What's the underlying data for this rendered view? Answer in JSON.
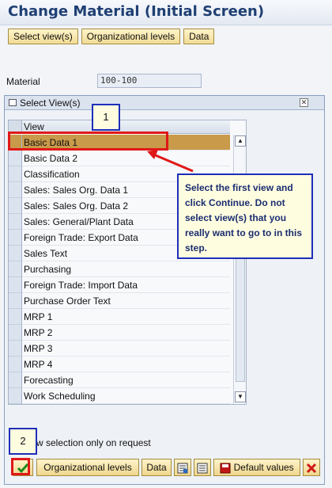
{
  "title": "Change Material (Initial Screen)",
  "toolbar": {
    "select_views": "Select view(s)",
    "org_levels": "Organizational levels",
    "data": "Data"
  },
  "material": {
    "label": "Material",
    "value": "100-100"
  },
  "dialog": {
    "title": "Select View(s)",
    "column_header": "View",
    "views": [
      "Basic Data 1",
      "Basic Data 2",
      "Classification",
      "Sales: Sales Org. Data 1",
      "Sales: Sales Org. Data 2",
      "Sales: General/Plant Data",
      "Foreign Trade: Export Data",
      "Sales Text",
      "Purchasing",
      "Foreign Trade: Import Data",
      "Purchase Order Text",
      "MRP 1",
      "MRP 2",
      "MRP 3",
      "MRP 4",
      "Forecasting",
      "Work Scheduling"
    ],
    "selected_index": 0,
    "footer_note": "w selection only on request",
    "buttons": {
      "org_levels": "Organizational levels",
      "data": "Data",
      "default_values": "Default values"
    }
  },
  "callouts": {
    "step1": "1",
    "step2": "2",
    "instruction": "Select the first view and click Continue. Do not select view(s) that you really want to go to in this step."
  },
  "colors": {
    "title": "#1f3f73",
    "selected_row": "#c89a4a",
    "highlight": "#e01818",
    "callout_border": "#1e2fb8",
    "callout_text": "#1a2d70",
    "callout_bg": "#fffde0",
    "button_bg": "#f1dc96"
  }
}
